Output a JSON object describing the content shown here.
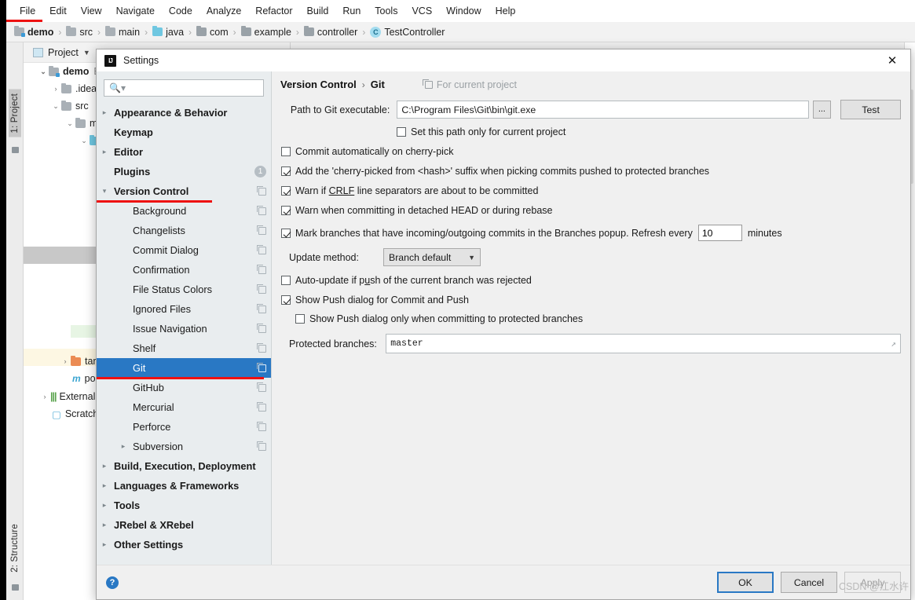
{
  "menubar": {
    "items": [
      {
        "label": "File"
      },
      {
        "label": "Edit"
      },
      {
        "label": "View"
      },
      {
        "label": "Navigate"
      },
      {
        "label": "Code"
      },
      {
        "label": "Analyze"
      },
      {
        "label": "Refactor"
      },
      {
        "label": "Build"
      },
      {
        "label": "Run"
      },
      {
        "label": "Tools"
      },
      {
        "label": "VCS"
      },
      {
        "label": "Window"
      },
      {
        "label": "Help"
      }
    ]
  },
  "breadcrumb": {
    "items": [
      {
        "label": "demo",
        "icon": "folder-module-icon"
      },
      {
        "label": "src",
        "icon": "folder-icon"
      },
      {
        "label": "main",
        "icon": "folder-icon"
      },
      {
        "label": "java",
        "icon": "folder-source-icon"
      },
      {
        "label": "com",
        "icon": "folder-package-icon"
      },
      {
        "label": "example",
        "icon": "folder-package-icon"
      },
      {
        "label": "controller",
        "icon": "folder-package-icon"
      },
      {
        "label": "TestController",
        "icon": "class-icon"
      }
    ],
    "separator": "›"
  },
  "tool_windows": {
    "left_tab_project": "1: Project",
    "left_tab_structure": "2: Structure"
  },
  "project_panel": {
    "title": "Project",
    "tree": [
      {
        "label": "demo",
        "suffix": "E",
        "arrow": "⌄",
        "depth": 0,
        "bold": true
      },
      {
        "label": ".idea",
        "arrow": "›",
        "depth": 1
      },
      {
        "label": "src",
        "arrow": "⌄",
        "depth": 1
      },
      {
        "label": "m",
        "arrow": "⌄",
        "depth": 2
      },
      {
        "label": "",
        "arrow": "⌄",
        "depth": 3
      },
      {
        "label": "",
        "arrow": "⌄",
        "depth": 4
      }
    ],
    "lower": [
      {
        "label": "targe",
        "arrow": "›"
      },
      {
        "label": "pom."
      },
      {
        "label": "External",
        "arrow": "›"
      },
      {
        "label": "Scratche"
      }
    ]
  },
  "dialog": {
    "title": "Settings",
    "close_label": "✕",
    "logo_text": "IJ",
    "search": {
      "value": "",
      "placeholder": ""
    },
    "sidebar": [
      {
        "label": "Appearance & Behavior",
        "arrow": "›",
        "depth": 0,
        "bold": true,
        "right": "none"
      },
      {
        "label": "Keymap",
        "arrow": "",
        "depth": 0,
        "bold": true,
        "right": "none"
      },
      {
        "label": "Editor",
        "arrow": "›",
        "depth": 0,
        "bold": true,
        "right": "none"
      },
      {
        "label": "Plugins",
        "arrow": "",
        "depth": 0,
        "bold": true,
        "right": "badge",
        "badge": "1"
      },
      {
        "label": "Version Control",
        "arrow": "⌄",
        "depth": 0,
        "bold": true,
        "right": "copy",
        "underlined": true
      },
      {
        "label": "Background",
        "arrow": "",
        "depth": 1,
        "bold": false,
        "right": "copy"
      },
      {
        "label": "Changelists",
        "arrow": "",
        "depth": 1,
        "bold": false,
        "right": "copy"
      },
      {
        "label": "Commit Dialog",
        "arrow": "",
        "depth": 1,
        "bold": false,
        "right": "copy"
      },
      {
        "label": "Confirmation",
        "arrow": "",
        "depth": 1,
        "bold": false,
        "right": "copy"
      },
      {
        "label": "File Status Colors",
        "arrow": "",
        "depth": 1,
        "bold": false,
        "right": "copy"
      },
      {
        "label": "Ignored Files",
        "arrow": "",
        "depth": 1,
        "bold": false,
        "right": "copy"
      },
      {
        "label": "Issue Navigation",
        "arrow": "",
        "depth": 1,
        "bold": false,
        "right": "copy"
      },
      {
        "label": "Shelf",
        "arrow": "",
        "depth": 1,
        "bold": false,
        "right": "copy"
      },
      {
        "label": "Git",
        "arrow": "",
        "depth": 1,
        "bold": false,
        "right": "copy",
        "selected": true,
        "underlined": true
      },
      {
        "label": "GitHub",
        "arrow": "",
        "depth": 1,
        "bold": false,
        "right": "copy"
      },
      {
        "label": "Mercurial",
        "arrow": "",
        "depth": 1,
        "bold": false,
        "right": "copy"
      },
      {
        "label": "Perforce",
        "arrow": "",
        "depth": 1,
        "bold": false,
        "right": "copy"
      },
      {
        "label": "Subversion",
        "arrow": "›",
        "depth": 1,
        "bold": false,
        "right": "copy"
      },
      {
        "label": "Build, Execution, Deployment",
        "arrow": "›",
        "depth": 0,
        "bold": true,
        "right": "none"
      },
      {
        "label": "Languages & Frameworks",
        "arrow": "›",
        "depth": 0,
        "bold": true,
        "right": "none"
      },
      {
        "label": "Tools",
        "arrow": "›",
        "depth": 0,
        "bold": true,
        "right": "none"
      },
      {
        "label": "JRebel & XRebel",
        "arrow": "›",
        "depth": 0,
        "bold": true,
        "right": "none"
      },
      {
        "label": "Other Settings",
        "arrow": "›",
        "depth": 0,
        "bold": true,
        "right": "none"
      }
    ],
    "content": {
      "crumb_parent": "Version Control",
      "crumb_sep": "›",
      "crumb_current": "Git",
      "for_current_project": "For current project",
      "path_label": "Path to Git executable:",
      "path_value": "C:\\Program Files\\Git\\bin\\git.exe",
      "browse_label": "...",
      "test_label": "Test",
      "checkbox_set_path": {
        "label": "Set this path only for current project",
        "checked": false
      },
      "checkbox_cherry_auto": {
        "label": "Commit automatically on cherry-pick",
        "checked": false
      },
      "checkbox_cherry_suffix": {
        "label": "Add the 'cherry-picked from <hash>' suffix when picking commits pushed to protected branches",
        "checked": true
      },
      "checkbox_crlf": {
        "label_pre": "Warn if ",
        "label_u": "CRLF",
        "label_post": " line separators are about to be committed",
        "checked": true
      },
      "checkbox_detached": {
        "label": "Warn when committing in detached HEAD or during rebase",
        "checked": true
      },
      "checkbox_mark_branches": {
        "label_pre": "Mark branches that have incoming/outgoing commits in the Branches popup.  Refresh every",
        "label_post": "minutes",
        "checked": true,
        "refresh_minutes": "10"
      },
      "update_method_label": "Update method:",
      "update_method_value": "Branch default",
      "checkbox_autoupdate": {
        "label_pre": "Auto-update if p",
        "label_u": "u",
        "label_post": "sh of the current branch was rejected",
        "checked": false
      },
      "checkbox_show_push": {
        "label": "Show Push dialog for Commit and Push",
        "checked": true
      },
      "checkbox_show_push_protected": {
        "label": "Show Push dialog only when committing to protected branches",
        "checked": false
      },
      "protected_branches_label": "Protected branches:",
      "protected_branches_value": "master"
    },
    "footer": {
      "help_label": "?",
      "ok_label": "OK",
      "cancel_label": "Cancel",
      "apply_label": "Apply"
    }
  },
  "watermark": "CSDN @江水许"
}
